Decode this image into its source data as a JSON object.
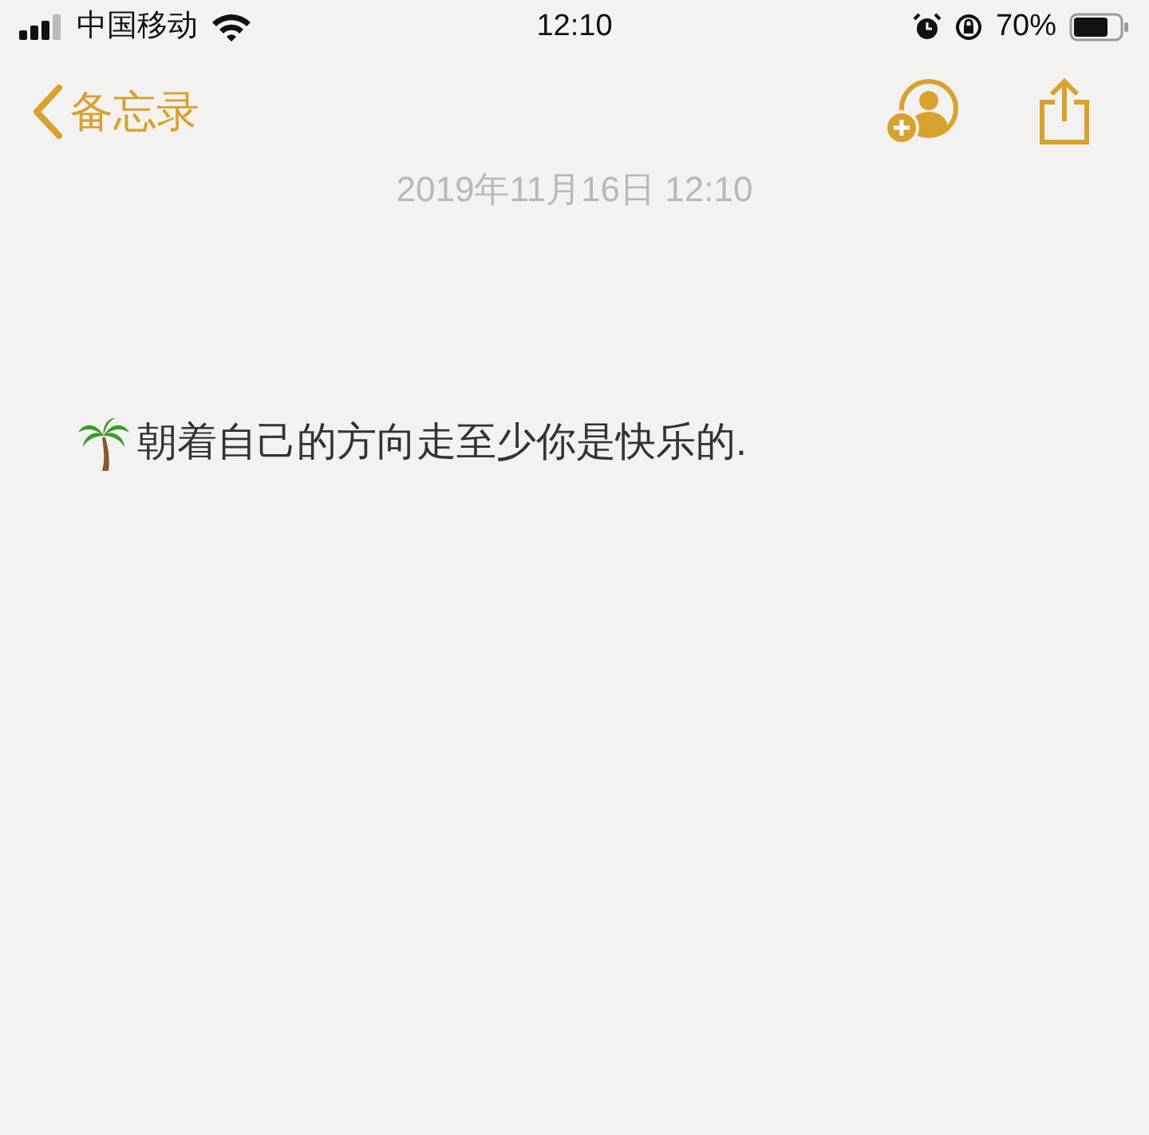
{
  "status_bar": {
    "carrier": "中国移动",
    "time": "12:10",
    "battery": "70%"
  },
  "nav": {
    "back_label": "备忘录"
  },
  "note": {
    "date": "2019年11月16日 12:10",
    "text": "朝着自己的方向走至少你是快乐的."
  }
}
